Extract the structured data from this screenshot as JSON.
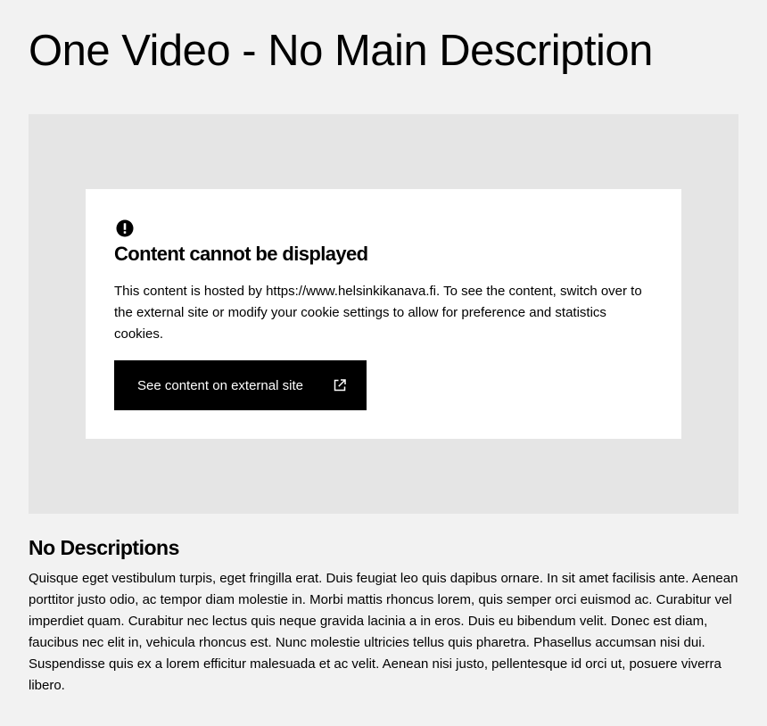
{
  "page": {
    "title": "One Video - No Main Description"
  },
  "video_notice": {
    "heading": "Content cannot be displayed",
    "text": "This content is hosted by https://www.helsinkikanava.fi. To see the content, switch over to the external site or modify your cookie settings to allow for preference and statistics cookies.",
    "button_label": "See content on external site",
    "icons": {
      "alert": "exclamation-circle-icon",
      "button": "external-link-icon"
    }
  },
  "section": {
    "heading": "No Descriptions",
    "body": "Quisque eget vestibulum turpis, eget fringilla erat. Duis feugiat leo quis dapibus ornare. In sit amet facilisis ante. Aenean porttitor justo odio, ac tempor diam molestie in. Morbi mattis rhoncus lorem, quis semper orci euismod ac. Curabitur vel imperdiet quam. Curabitur nec lectus quis neque gravida lacinia a in eros. Duis eu bibendum velit. Donec est diam, faucibus nec elit in, vehicula rhoncus est. Nunc molestie ultricies tellus quis pharetra. Phasellus accumsan nisi dui. Suspendisse quis ex a lorem efficitur malesuada et ac velit. Aenean nisi justo, pellentesque id orci ut, posuere viverra libero."
  },
  "colors": {
    "page_background": "#f2f2f2",
    "video_placeholder": "#e5e5e5",
    "notice_background": "#ffffff",
    "button_background": "#000000",
    "button_text": "#ffffff",
    "text": "#000000"
  }
}
